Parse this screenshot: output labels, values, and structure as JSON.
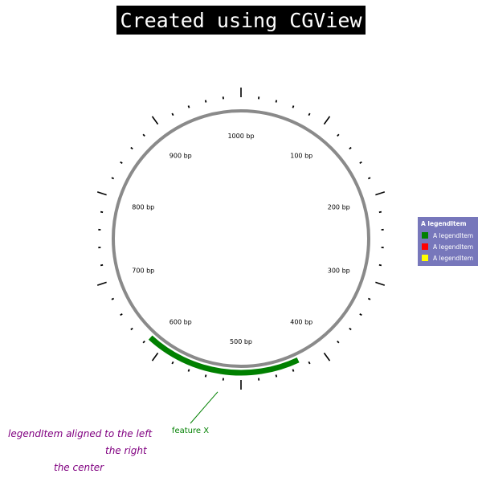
{
  "title": "Created using CGView",
  "sequence": {
    "length": 1000,
    "tick_labels": [
      "100 bp",
      "200 bp",
      "300 bp",
      "400 bp",
      "500 bp",
      "600 bp",
      "700 bp",
      "800 bp",
      "900 bp",
      "1000 bp"
    ]
  },
  "feature": {
    "label": "feature X",
    "start": 430,
    "end": 618,
    "color": "#008000"
  },
  "backbone_color": "#8a8a8a",
  "legend": {
    "title": "A legendItem",
    "background": "#7777bb",
    "items": [
      {
        "label": "A legendItem",
        "color": "#008000"
      },
      {
        "label": "A legendItem",
        "color": "#ff0000"
      },
      {
        "label": "A legendItem",
        "color": "#ffff00"
      }
    ]
  },
  "notes": {
    "left": "legendItem aligned to the left",
    "right": "the right",
    "center": "the center",
    "color": "#800080"
  }
}
